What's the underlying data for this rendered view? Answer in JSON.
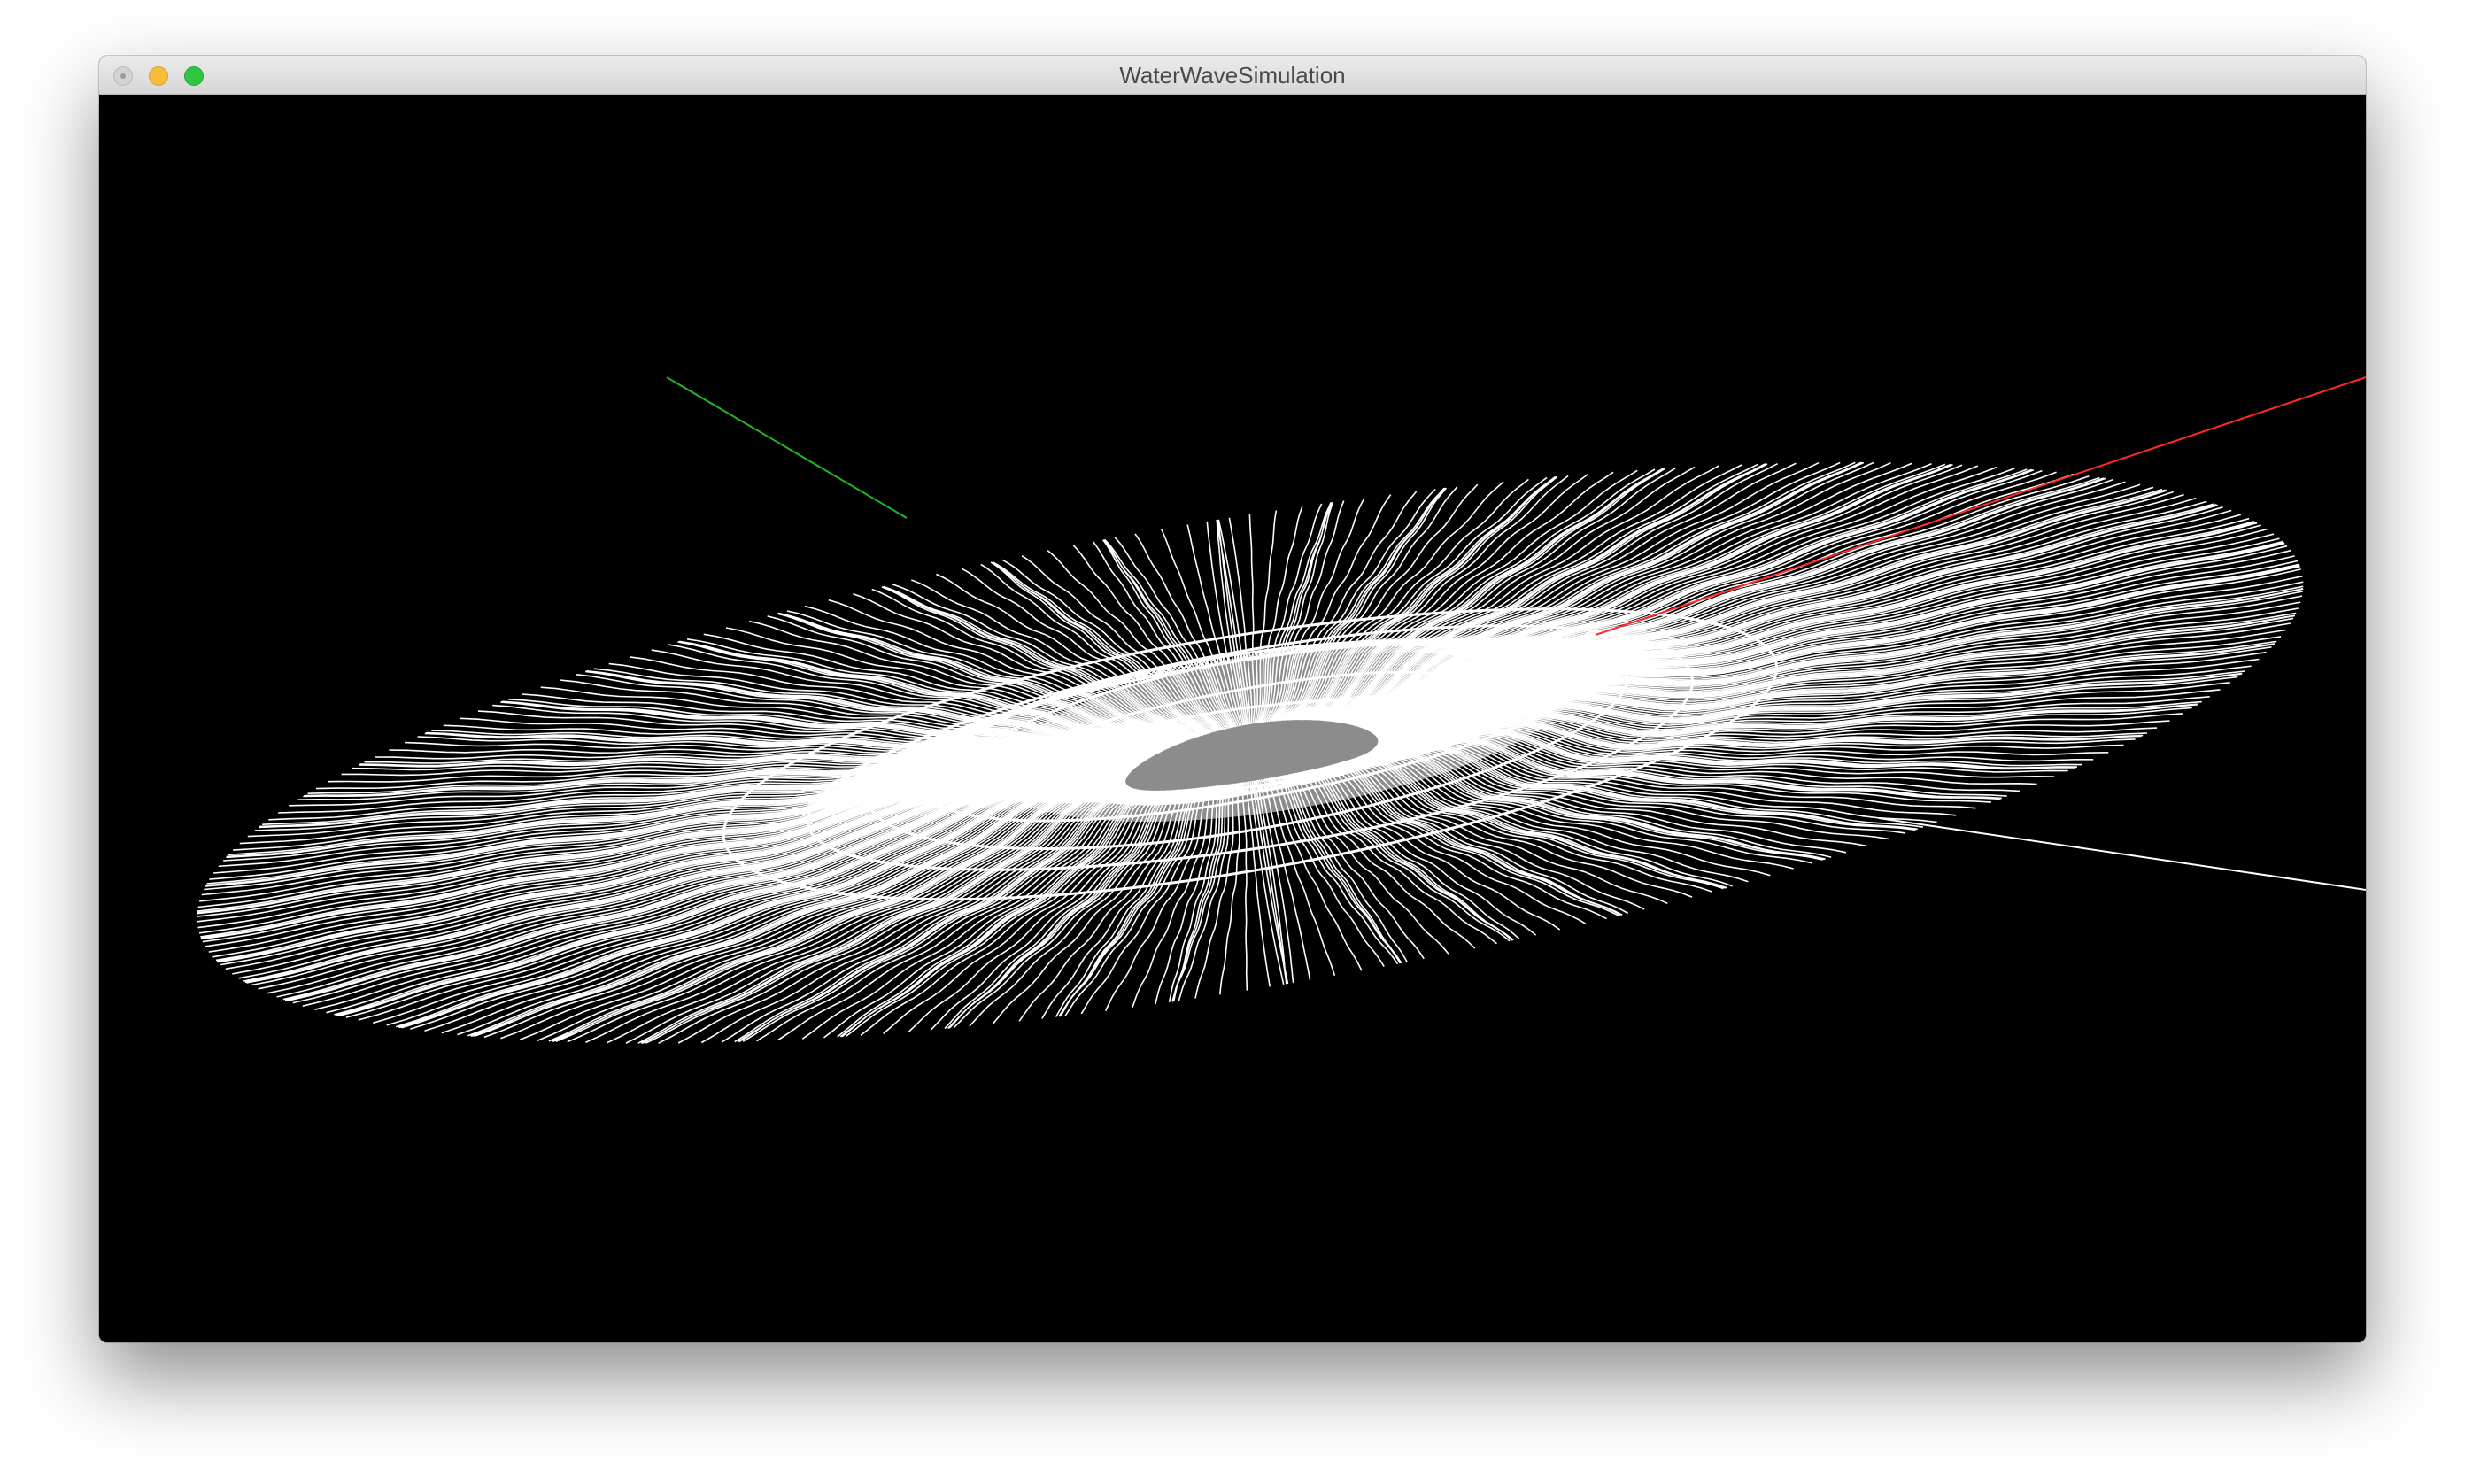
{
  "window": {
    "title": "WaterWaveSimulation"
  },
  "scene": {
    "background_color": "#000000",
    "mesh_color": "#ffffff",
    "axis_colors": {
      "x_axis": "#ff2a2a",
      "y_axis": "#22b722",
      "z_axis": "#ffffff"
    },
    "mesh": "wireframe circular water surface with concentric ripple"
  },
  "icons": {
    "close": "close-icon",
    "minimize": "minimize-icon",
    "zoom": "zoom-icon"
  }
}
